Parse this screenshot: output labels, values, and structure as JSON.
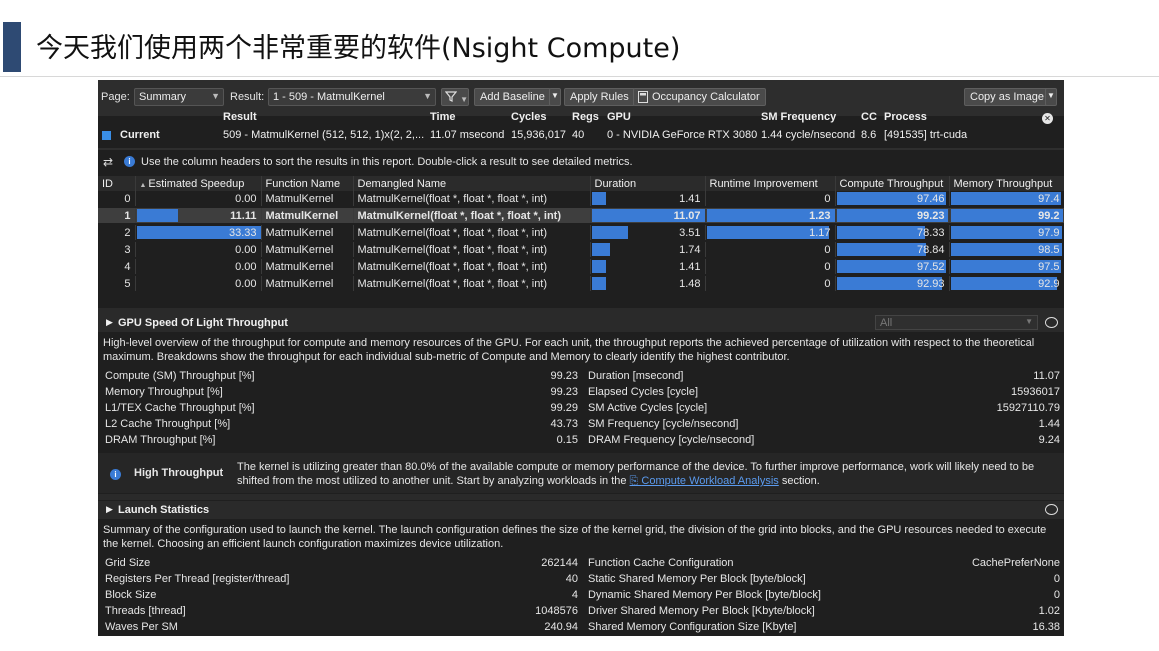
{
  "slide": {
    "title": "今天我们使用两个非常重要的软件(Nsight Compute)"
  },
  "toolbar": {
    "page_label": "Page:",
    "page_value": "Summary",
    "result_label": "Result:",
    "result_value": "1 -   509 - MatmulKernel",
    "filter_icon": "filter-icon",
    "add_baseline": "Add Baseline",
    "apply_rules": "Apply Rules",
    "occupancy_calculator": "Occupancy Calculator",
    "copy_as_image": "Copy as Image"
  },
  "result_header": {
    "col_result": "Result",
    "col_time": "Time",
    "col_cycles": "Cycles",
    "col_regs": "Regs",
    "col_gpu": "GPU",
    "col_sm_freq": "SM Frequency",
    "col_cc": "CC",
    "col_process": "Process",
    "current_label": "Current",
    "result": "509 - MatmulKernel (512, 512, 1)x(2, 2,...",
    "time": "11.07 msecond",
    "cycles": "15,936,017",
    "regs": "40",
    "gpu": "0 - NVIDIA GeForce RTX 3080",
    "sm_freq": "1.44 cycle/nsecond",
    "cc": "8.6",
    "process": "[491535] trt-cuda"
  },
  "hint": "Use the column headers to sort the results in this report. Double-click a result to see detailed metrics.",
  "table": {
    "headers": [
      "ID",
      "Estimated Speedup",
      "Function Name",
      "Demangled Name",
      "Duration",
      "Runtime Improvement",
      "Compute Throughput",
      "Memory Throughput"
    ],
    "rows": [
      {
        "id": "0",
        "speedup": "0.00",
        "fn": "MatmulKernel",
        "dem": "MatmulKernel(float *, float *, float *, int)",
        "dur": "1.41",
        "rt": "0",
        "ct": "97.46",
        "mt": "97.4"
      },
      {
        "id": "1",
        "speedup": "11.11",
        "fn": "MatmulKernel",
        "dem": "MatmulKernel(float *, float *, float *, int)",
        "dur": "11.07",
        "rt": "1.23",
        "ct": "99.23",
        "mt": "99.2"
      },
      {
        "id": "2",
        "speedup": "33.33",
        "fn": "MatmulKernel",
        "dem": "MatmulKernel(float *, float *, float *, int)",
        "dur": "3.51",
        "rt": "1.17",
        "ct": "78.33",
        "mt": "97.9"
      },
      {
        "id": "3",
        "speedup": "0.00",
        "fn": "MatmulKernel",
        "dem": "MatmulKernel(float *, float *, float *, int)",
        "dur": "1.74",
        "rt": "0",
        "ct": "78.84",
        "mt": "98.5"
      },
      {
        "id": "4",
        "speedup": "0.00",
        "fn": "MatmulKernel",
        "dem": "MatmulKernel(float *, float *, float *, int)",
        "dur": "1.41",
        "rt": "0",
        "ct": "97.52",
        "mt": "97.5"
      },
      {
        "id": "5",
        "speedup": "0.00",
        "fn": "MatmulKernel",
        "dem": "MatmulKernel(float *, float *, float *, int)",
        "dur": "1.48",
        "rt": "0",
        "ct": "92.93",
        "mt": "92.9"
      }
    ]
  },
  "sol": {
    "title": "GPU Speed Of Light Throughput",
    "filter_value": "All",
    "desc": "High-level overview of the throughput for compute and memory resources of the GPU. For each unit, the throughput reports the achieved percentage of utilization with respect to the theoretical maximum. Breakdowns show the throughput for each individual sub-metric of Compute and Memory to clearly identify the highest contributor.",
    "left": [
      {
        "k": "Compute (SM) Throughput [%]",
        "v": "99.23"
      },
      {
        "k": "Memory Throughput [%]",
        "v": "99.23"
      },
      {
        "k": "L1/TEX Cache Throughput [%]",
        "v": "99.29"
      },
      {
        "k": "L2 Cache Throughput [%]",
        "v": "43.73"
      },
      {
        "k": "DRAM Throughput [%]",
        "v": "0.15"
      }
    ],
    "right": [
      {
        "k": "Duration [msecond]",
        "v": "11.07"
      },
      {
        "k": "Elapsed Cycles [cycle]",
        "v": "15936017"
      },
      {
        "k": "SM Active Cycles [cycle]",
        "v": "15927110.79"
      },
      {
        "k": "SM Frequency [cycle/nsecond]",
        "v": "1.44"
      },
      {
        "k": "DRAM Frequency [cycle/nsecond]",
        "v": "9.24"
      }
    ],
    "rule_title": "High Throughput",
    "rule_text_1": "The kernel is utilizing greater than 80.0% of the available compute or memory performance of the device. To further improve performance, work will likely need to be",
    "rule_text_2a": "shifted from the most utilized to another unit. Start by analyzing workloads in the",
    "rule_link": "Compute Workload Analysis",
    "rule_text_2b": "section."
  },
  "launch": {
    "title": "Launch Statistics",
    "desc": "Summary of the configuration used to launch the kernel. The launch configuration defines the size of the kernel grid, the division of the grid into blocks, and the GPU resources needed to execute the kernel. Choosing an efficient launch configuration maximizes device utilization.",
    "left": [
      {
        "k": "Grid Size",
        "v": "262144"
      },
      {
        "k": "Registers Per Thread [register/thread]",
        "v": "40"
      },
      {
        "k": "Block Size",
        "v": "4"
      },
      {
        "k": "Threads [thread]",
        "v": "1048576"
      },
      {
        "k": "Waves Per SM",
        "v": "240.94"
      }
    ],
    "right": [
      {
        "k": "Function Cache Configuration",
        "v": "CachePreferNone"
      },
      {
        "k": "Static Shared Memory Per Block [byte/block]",
        "v": "0"
      },
      {
        "k": "Dynamic Shared Memory Per Block [byte/block]",
        "v": "0"
      },
      {
        "k": "Driver Shared Memory Per Block [Kbyte/block]",
        "v": "1.02"
      },
      {
        "k": "Shared Memory Configuration Size [Kbyte]",
        "v": "16.38"
      }
    ]
  }
}
